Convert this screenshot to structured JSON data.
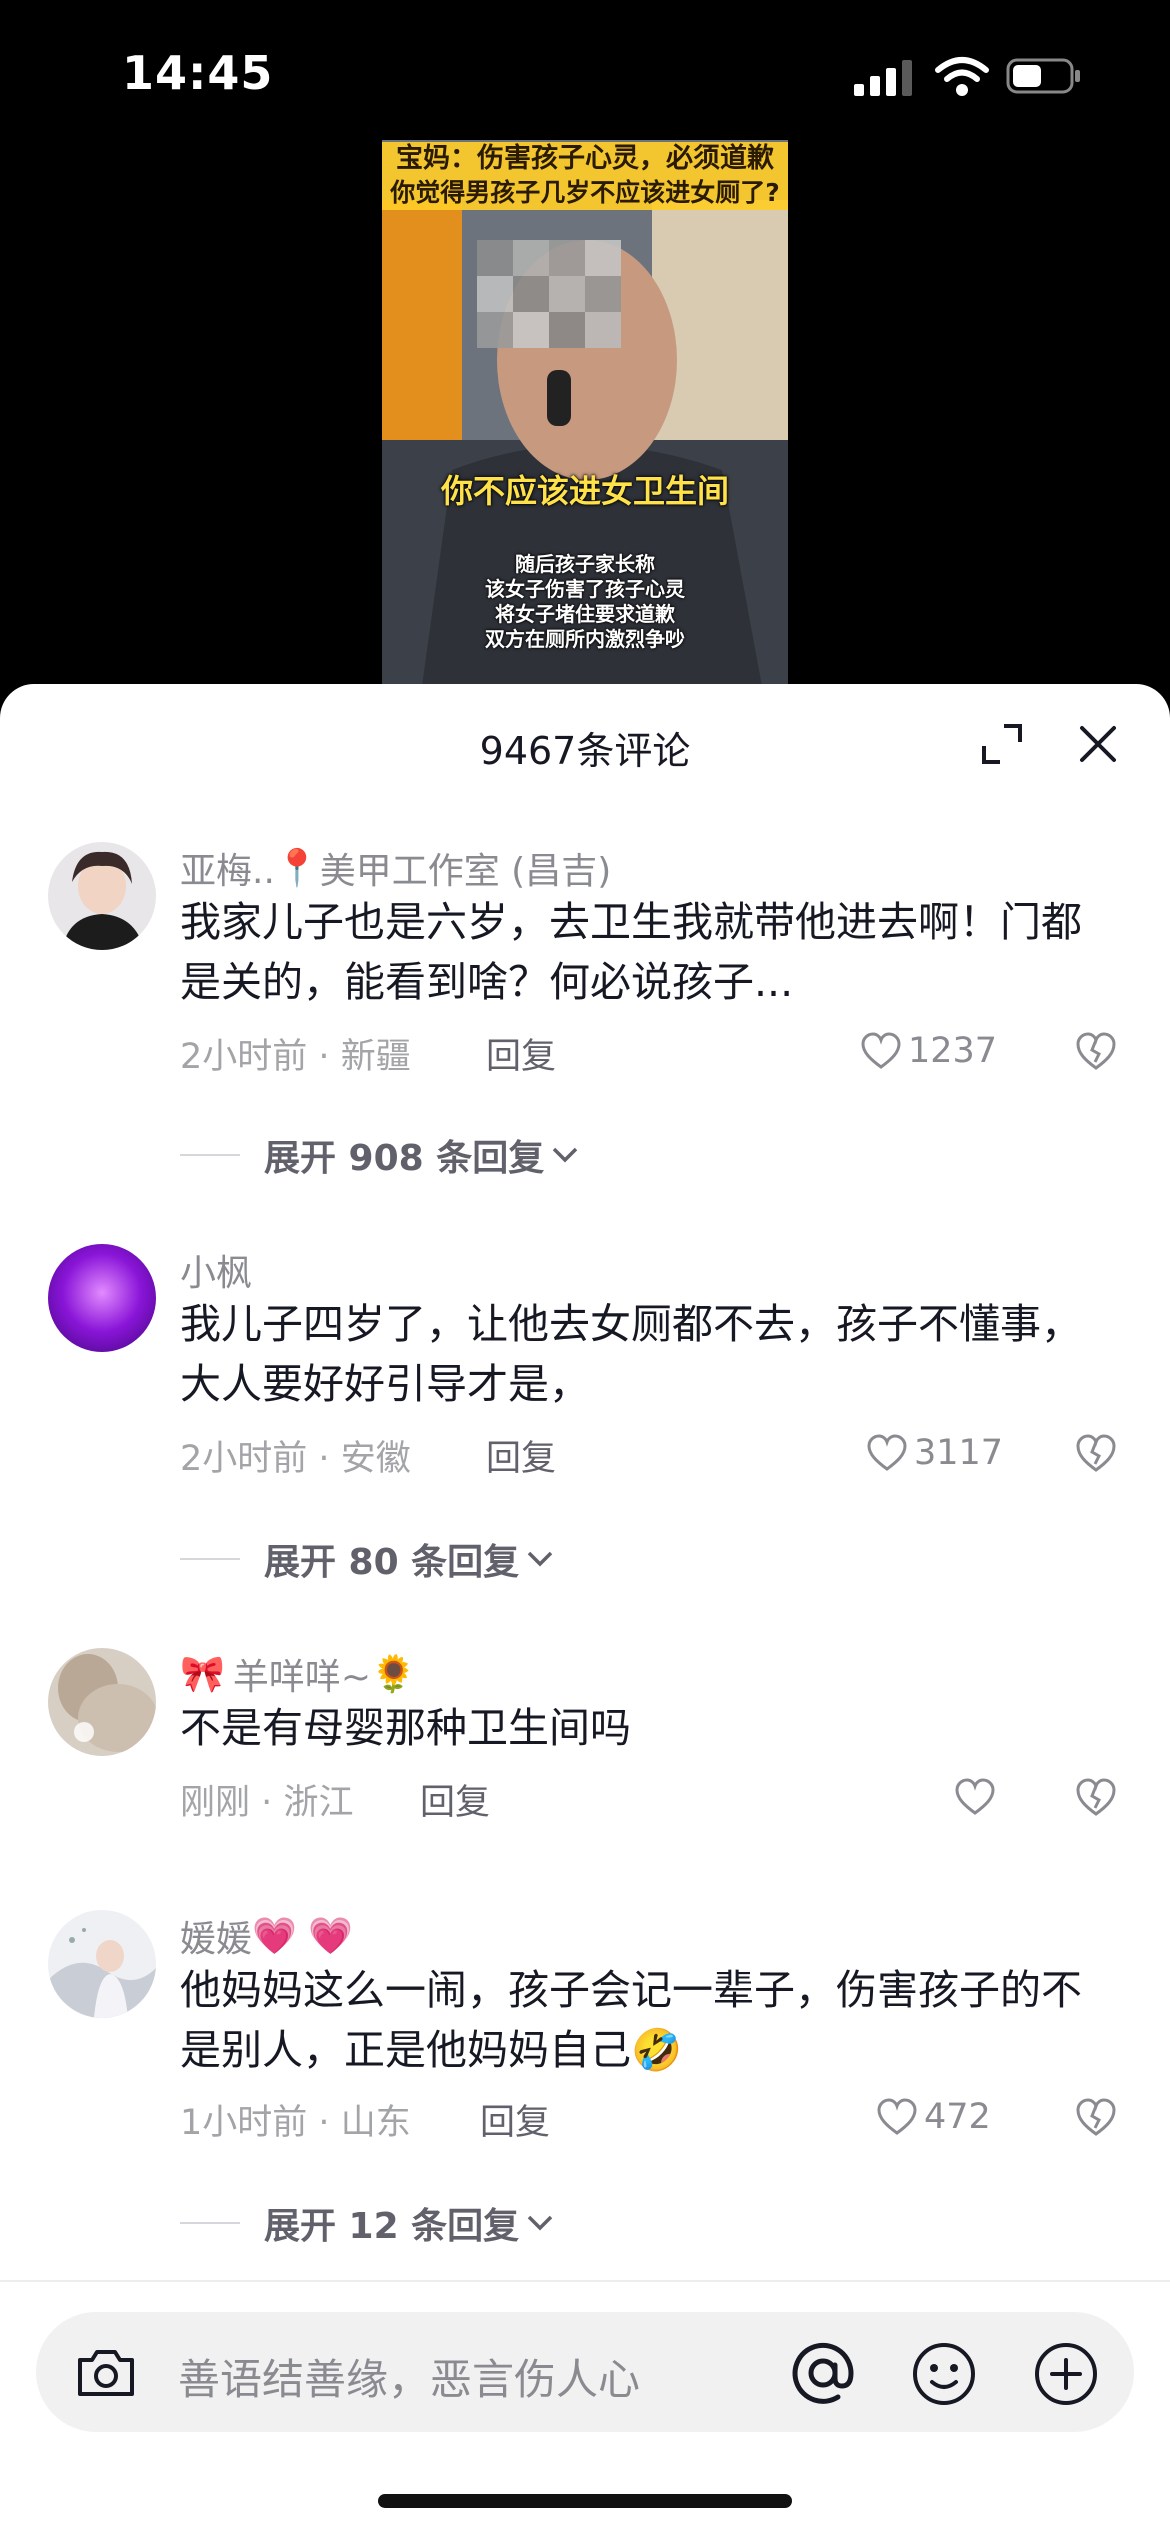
{
  "status_bar": {
    "time": "14:45"
  },
  "video": {
    "title_line1": "宝妈：伤害孩子心灵，必须道歉",
    "title_line2": "你觉得男孩子几岁不应该进女厕了?",
    "subtitle": "你不应该进女卫生间",
    "caption": [
      "随后孩子家长称",
      "该女子伤害了孩子心灵",
      "将女子堵住要求道歉",
      "双方在厕所内激烈争吵"
    ]
  },
  "sheet": {
    "title": "9467条评论"
  },
  "comments": [
    {
      "name": "亚梅..",
      "name_emoji": "📍",
      "name_suffix": "美甲工作室 (昌吉)",
      "text": "我家儿子也是六岁，去卫生我就带他进去啊！门都是关的，能看到啥？何必说孩子...",
      "time": "2小时前",
      "dot": "·",
      "location": "新疆",
      "reply_label": "回复",
      "likes": "1237",
      "expand_label": "展开 908 条回复"
    },
    {
      "name": "小枫",
      "text": "我儿子四岁了，让他去女厕都不去，孩子不懂事，大人要好好引导才是，",
      "time": "2小时前",
      "dot": "·",
      "location": "安徽",
      "reply_label": "回复",
      "likes": "3117",
      "expand_label": "展开 80 条回复"
    },
    {
      "name_prefix_emoji": "🎀",
      "name": "羊咩咩~",
      "name_emoji": "🌻",
      "text": "不是有母婴那种卫生间吗",
      "time": "刚刚",
      "dot": "·",
      "location": "浙江",
      "reply_label": "回复",
      "likes": ""
    },
    {
      "name": "媛媛",
      "name_emoji": "💗 💗",
      "text": "他妈妈这么一闹，孩子会记一辈子，伤害孩子的不是别人，正是他妈妈自己🤣",
      "time": "1小时前",
      "dot": "·",
      "location": "山东",
      "reply_label": "回复",
      "likes": "472",
      "expand_label": "展开 12 条回复"
    }
  ],
  "input": {
    "placeholder": "善语结善缘，恶言伤人心"
  },
  "icons": {
    "expand": "expand-icon",
    "close": "close-icon",
    "heart": "heart-outline-icon",
    "dislike": "broken-heart-icon",
    "camera": "camera-icon",
    "at": "at-icon",
    "emoji": "smiley-icon",
    "plus": "plus-circle-icon"
  },
  "colors": {
    "text": "#161823",
    "muted": "#8a8b91",
    "sheet_bg": "#ffffff",
    "page_bg": "#000000",
    "video_banner": "#ffcd28"
  }
}
